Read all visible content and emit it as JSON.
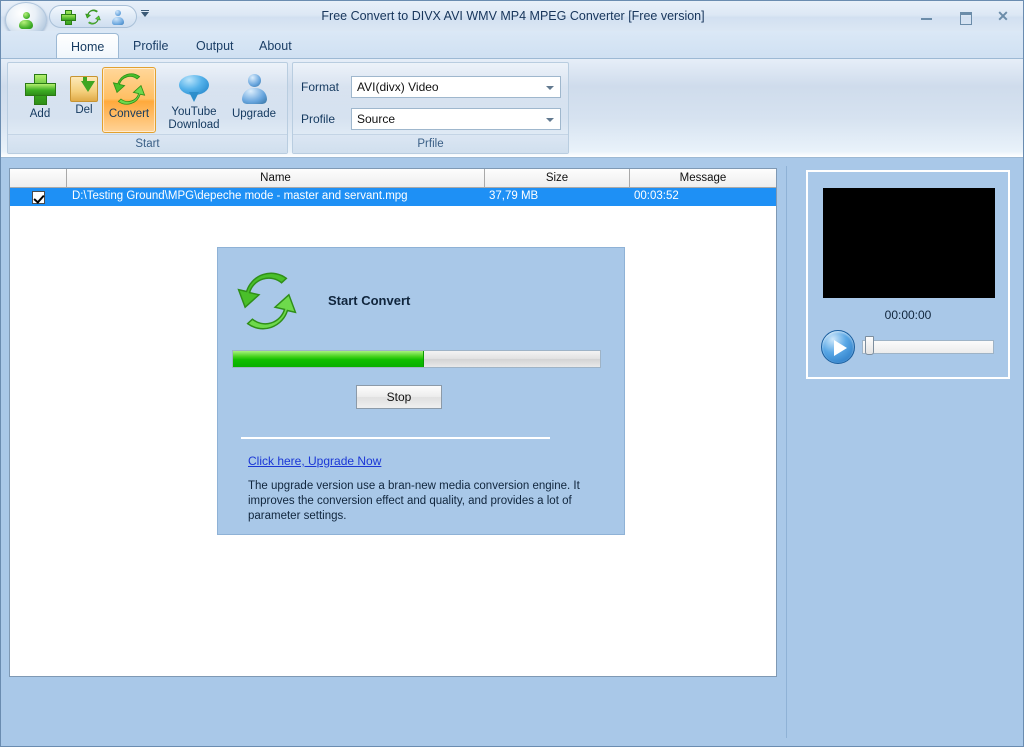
{
  "window": {
    "title": "Free Convert to DIVX AVI WMV MP4 MPEG Converter  [Free version]",
    "app_icon": "person-green-orb-icon",
    "controls": {
      "minimize": "minimize-icon",
      "maximize": "maximize-restore-icon",
      "close": "close-icon"
    }
  },
  "quick_access": {
    "items": [
      {
        "name": "add-icon",
        "glyph": "green-plus"
      },
      {
        "name": "convert-icon",
        "glyph": "green-recycle-arrows"
      },
      {
        "name": "upgrade-icon",
        "glyph": "blue-person"
      }
    ],
    "more_label": "customize-quick-access-icon"
  },
  "tabs": [
    {
      "label": "Home",
      "active": true
    },
    {
      "label": "Profile",
      "active": false
    },
    {
      "label": "Output",
      "active": false
    },
    {
      "label": "About",
      "active": false
    }
  ],
  "ribbon": {
    "groups": [
      {
        "label": "Start",
        "buttons": [
          {
            "label": "Add",
            "icon": "green-plus-icon",
            "selected": false
          },
          {
            "label": "Del",
            "icon": "delete-folder-icon",
            "selected": false
          },
          {
            "label": "Convert",
            "icon": "convert-arrows-icon",
            "selected": true
          },
          {
            "label": "YouTube Download",
            "line1": "YouTube",
            "line2": "Download",
            "icon": "youtube-bubble-icon",
            "selected": false
          },
          {
            "label": "Upgrade",
            "icon": "blue-person-icon",
            "selected": false
          }
        ]
      },
      {
        "label": "Prfile",
        "fields": [
          {
            "label": "Format",
            "value": "AVI(divx) Video"
          },
          {
            "label": "Profile",
            "value": "Source"
          }
        ]
      }
    ]
  },
  "filelist": {
    "columns": [
      "",
      "Name",
      "Size",
      "Message"
    ],
    "rows": [
      {
        "checked": true,
        "name": "D:\\Testing Ground\\MPG\\depeche mode - master and servant.mpg",
        "size": "37,79 MB",
        "message": "00:03:52",
        "selected": true
      }
    ]
  },
  "convert_panel": {
    "icon": "convert-arrows-icon",
    "title": "Start Convert",
    "progress_percent": 52,
    "stop_label": "Stop",
    "upgrade_link": "Click here, Upgrade Now",
    "upgrade_description": "The upgrade version use a bran-new media conversion engine. It improves the conversion effect and quality, and provides a lot of parameter settings."
  },
  "preview": {
    "time": "00:00:00",
    "play_icon": "play-icon",
    "seek_position_percent": 2
  },
  "colors": {
    "workspace_blue": "#a9c8e8",
    "selection_blue": "#1e90f5",
    "progress_green": "#11bf00",
    "accent_orange": "#ffa93c",
    "link_blue": "#1b37d6"
  }
}
